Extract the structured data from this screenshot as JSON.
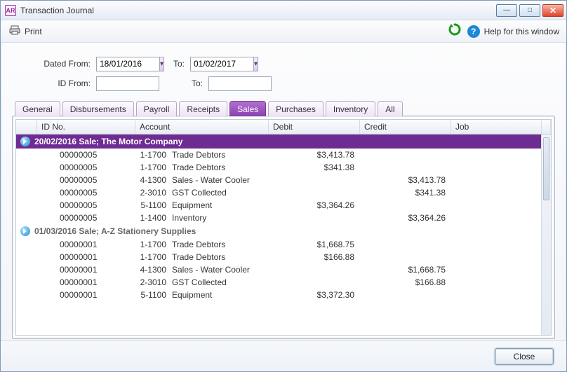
{
  "title": "Transaction Journal",
  "app_icon": "AR",
  "toolbar": {
    "print": "Print",
    "help": "Help for this window"
  },
  "filters": {
    "dated_from_label": "Dated From:",
    "dated_from": "18/01/2016",
    "dated_to_label": "To:",
    "dated_to": "01/02/2017",
    "id_from_label": "ID From:",
    "id_from": "",
    "id_to_label": "To:",
    "id_to": ""
  },
  "tabs": [
    "General",
    "Disbursements",
    "Payroll",
    "Receipts",
    "Sales",
    "Purchases",
    "Inventory",
    "All"
  ],
  "active_tab": "Sales",
  "columns": {
    "id": "ID No.",
    "account": "Account",
    "debit": "Debit",
    "credit": "Credit",
    "job": "Job"
  },
  "groups": [
    {
      "header": "20/02/2016  Sale; The Motor Company",
      "selected": true,
      "rows": [
        {
          "id": "00000005",
          "code": "1-1700",
          "name": "Trade Debtors",
          "debit": "$3,413.78",
          "credit": ""
        },
        {
          "id": "00000005",
          "code": "1-1700",
          "name": "Trade Debtors",
          "debit": "$341.38",
          "credit": ""
        },
        {
          "id": "00000005",
          "code": "4-1300",
          "name": "Sales - Water Cooler",
          "debit": "",
          "credit": "$3,413.78"
        },
        {
          "id": "00000005",
          "code": "2-3010",
          "name": "GST Collected",
          "debit": "",
          "credit": "$341.38"
        },
        {
          "id": "00000005",
          "code": "5-1100",
          "name": "Equipment",
          "debit": "$3,364.26",
          "credit": ""
        },
        {
          "id": "00000005",
          "code": "1-1400",
          "name": "Inventory",
          "debit": "",
          "credit": "$3,364.26"
        }
      ]
    },
    {
      "header": "01/03/2016  Sale; A-Z Stationery Supplies",
      "selected": false,
      "rows": [
        {
          "id": "00000001",
          "code": "1-1700",
          "name": "Trade Debtors",
          "debit": "$1,668.75",
          "credit": ""
        },
        {
          "id": "00000001",
          "code": "1-1700",
          "name": "Trade Debtors",
          "debit": "$166.88",
          "credit": ""
        },
        {
          "id": "00000001",
          "code": "4-1300",
          "name": "Sales - Water Cooler",
          "debit": "",
          "credit": "$1,668.75"
        },
        {
          "id": "00000001",
          "code": "2-3010",
          "name": "GST Collected",
          "debit": "",
          "credit": "$166.88"
        },
        {
          "id": "00000001",
          "code": "5-1100",
          "name": "Equipment",
          "debit": "$3,372.30",
          "credit": ""
        }
      ]
    }
  ],
  "close_button": "Close"
}
